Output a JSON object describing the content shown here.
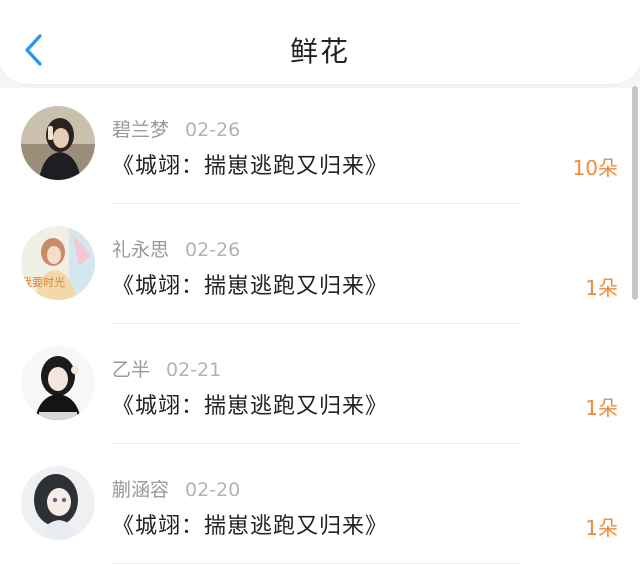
{
  "header": {
    "title": "鲜花",
    "back_icon": "chevron-left-icon"
  },
  "colors": {
    "accent": "#2196f3",
    "count": "#f28a3c",
    "name": "#999999",
    "date": "#b3b3b3",
    "title": "#222222"
  },
  "list": {
    "items": [
      {
        "name": "碧兰梦",
        "date": "02-26",
        "book": "《城翊：揣崽逃跑又归来》",
        "count": "10朵"
      },
      {
        "name": "礼永思",
        "date": "02-26",
        "book": "《城翊：揣崽逃跑又归来》",
        "count": "1朵",
        "avatar_text": "我要时光"
      },
      {
        "name": "乙半",
        "date": "02-21",
        "book": "《城翊：揣崽逃跑又归来》",
        "count": "1朵"
      },
      {
        "name": "蒯涵容",
        "date": "02-20",
        "book": "《城翊：揣崽逃跑又归来》",
        "count": "1朵"
      }
    ]
  }
}
